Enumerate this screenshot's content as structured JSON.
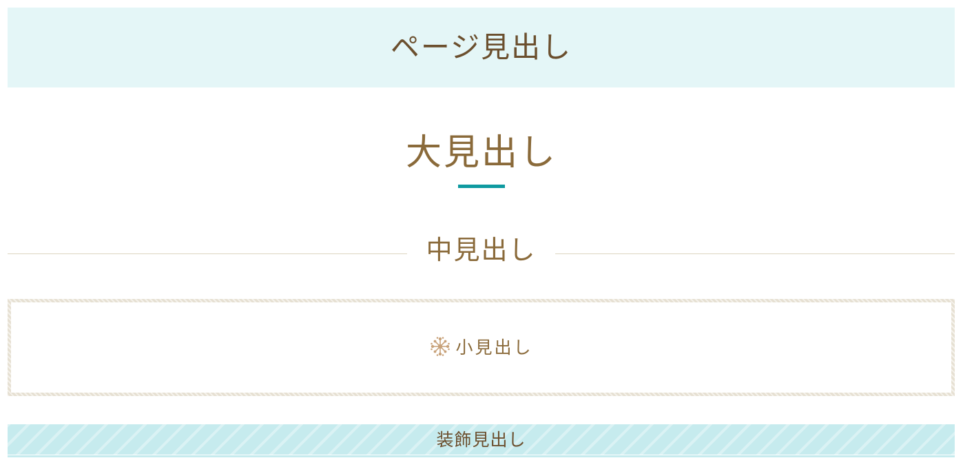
{
  "headings": {
    "page": "ページ見出し",
    "large": "大見出し",
    "medium": "中見出し",
    "small": "小見出し",
    "decorative": "装飾見出し"
  },
  "icons": {
    "small_heading_icon": "snowflake-ornament-icon"
  },
  "colors": {
    "text_brown": "#8a6a3a",
    "text_dark_brown": "#6b4f2e",
    "page_band_bg": "#e4f6f7",
    "accent_teal": "#0e9aa0",
    "rule_beige": "#ddd5c0",
    "box_border": "#e6e0d2",
    "deco_band_bg": "#c6ebee"
  }
}
